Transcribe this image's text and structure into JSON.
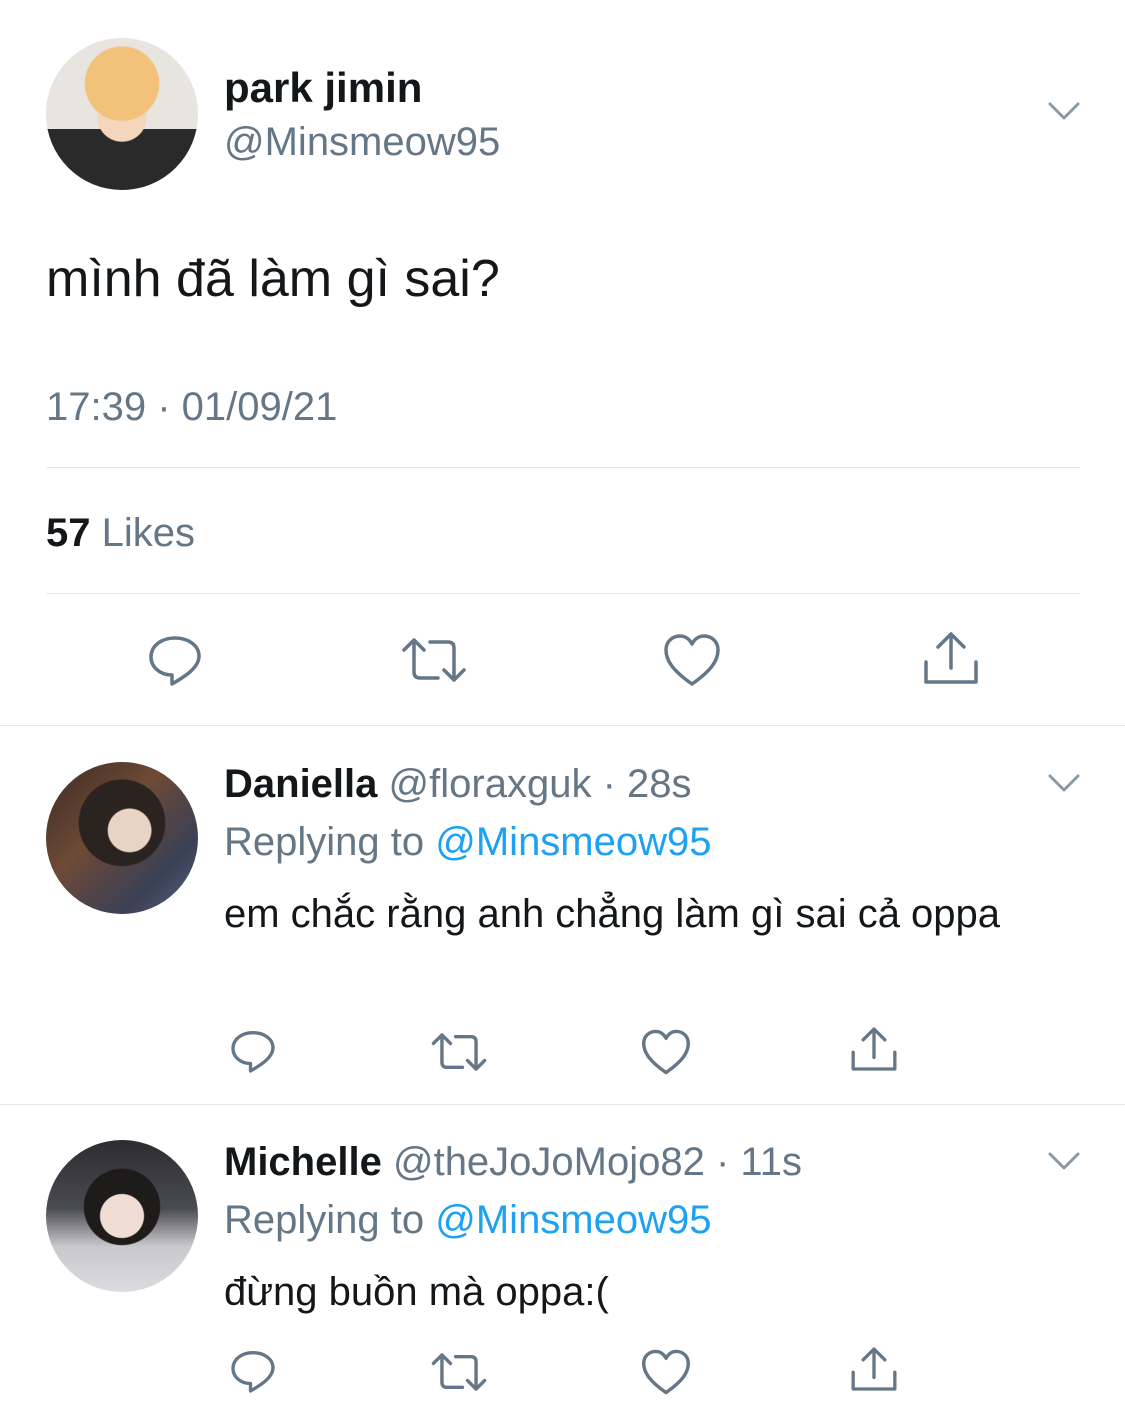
{
  "main_tweet": {
    "display_name": "park jimin",
    "handle": "@Minsmeow95",
    "text": "mình đã làm gì sai?",
    "timestamp": "17:39 · 01/09/21",
    "likes_count": "57",
    "likes_label": "Likes"
  },
  "replies": [
    {
      "display_name": "Daniella",
      "handle": "@floraxguk",
      "age": "· 28s",
      "replying_prefix": "Replying to",
      "replying_handle": "@Minsmeow95",
      "text": "em chắc rằng anh chẳng làm gì sai cả oppa"
    },
    {
      "display_name": "Michelle",
      "handle": "@theJoJoMojo82",
      "age": "· 11s",
      "replying_prefix": "Replying to",
      "replying_handle": "@Minsmeow95",
      "text": "đừng buồn mà oppa:("
    }
  ],
  "icons": {
    "reply": "reply-icon",
    "retweet": "retweet-icon",
    "like": "heart-icon",
    "share": "share-icon",
    "more": "chevron-down-icon"
  },
  "colors": {
    "text": "#14171a",
    "muted": "#657786",
    "link": "#1da1f2",
    "divider": "#e1e8ed"
  }
}
